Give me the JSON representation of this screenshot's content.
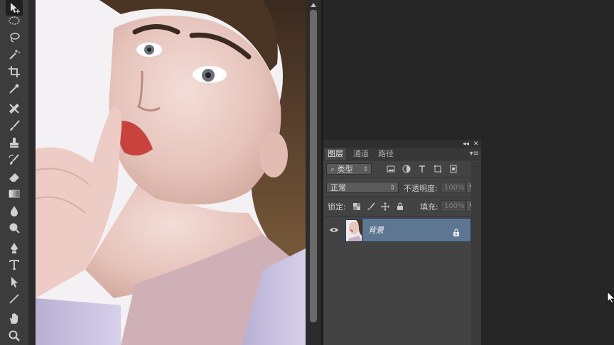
{
  "toolbar": {
    "tools": [
      {
        "name": "move-tool",
        "icon": "move-icon",
        "active": true
      },
      {
        "name": "elliptical-marquee-tool",
        "icon": "ellipse-marquee-icon"
      },
      {
        "name": "lasso-tool",
        "icon": "lasso-icon"
      },
      {
        "name": "magic-wand-tool",
        "icon": "magic-wand-icon"
      },
      {
        "name": "crop-tool",
        "icon": "crop-icon"
      },
      {
        "name": "eyedropper-tool",
        "icon": "eyedropper-icon"
      },
      {
        "name": "healing-brush-tool",
        "icon": "healing-icon"
      },
      {
        "name": "brush-tool",
        "icon": "brush-icon"
      },
      {
        "name": "clone-stamp-tool",
        "icon": "stamp-icon"
      },
      {
        "name": "history-brush-tool",
        "icon": "history-brush-icon"
      },
      {
        "name": "eraser-tool",
        "icon": "eraser-icon"
      },
      {
        "name": "gradient-tool",
        "icon": "gradient-icon"
      },
      {
        "name": "blur-tool",
        "icon": "blur-icon"
      },
      {
        "name": "dodge-tool",
        "icon": "dodge-icon"
      },
      {
        "name": "pen-tool",
        "icon": "pen-icon"
      },
      {
        "name": "type-tool",
        "icon": "type-icon"
      },
      {
        "name": "path-selection-tool",
        "icon": "path-select-icon"
      },
      {
        "name": "line-tool",
        "icon": "line-icon"
      },
      {
        "name": "hand-tool",
        "icon": "hand-icon"
      },
      {
        "name": "zoom-tool",
        "icon": "zoom-icon"
      }
    ]
  },
  "layers_panel": {
    "tabs": [
      "图层",
      "通道",
      "路径"
    ],
    "active_tab": "图层",
    "filter_kind": "类型",
    "blend_mode": "正常",
    "opacity_label": "不透明度:",
    "opacity_value": "100%",
    "lock_label": "锁定:",
    "fill_label": "填充:",
    "fill_value": "100%",
    "layers": [
      {
        "name": "背景",
        "visible": true,
        "locked": true,
        "selected": true
      }
    ]
  },
  "colors": {
    "toolbar_bg": "#3c3c3c",
    "panel_bg": "#434343",
    "workspace_bg": "#262626",
    "layer_selected": "#5d7793"
  }
}
